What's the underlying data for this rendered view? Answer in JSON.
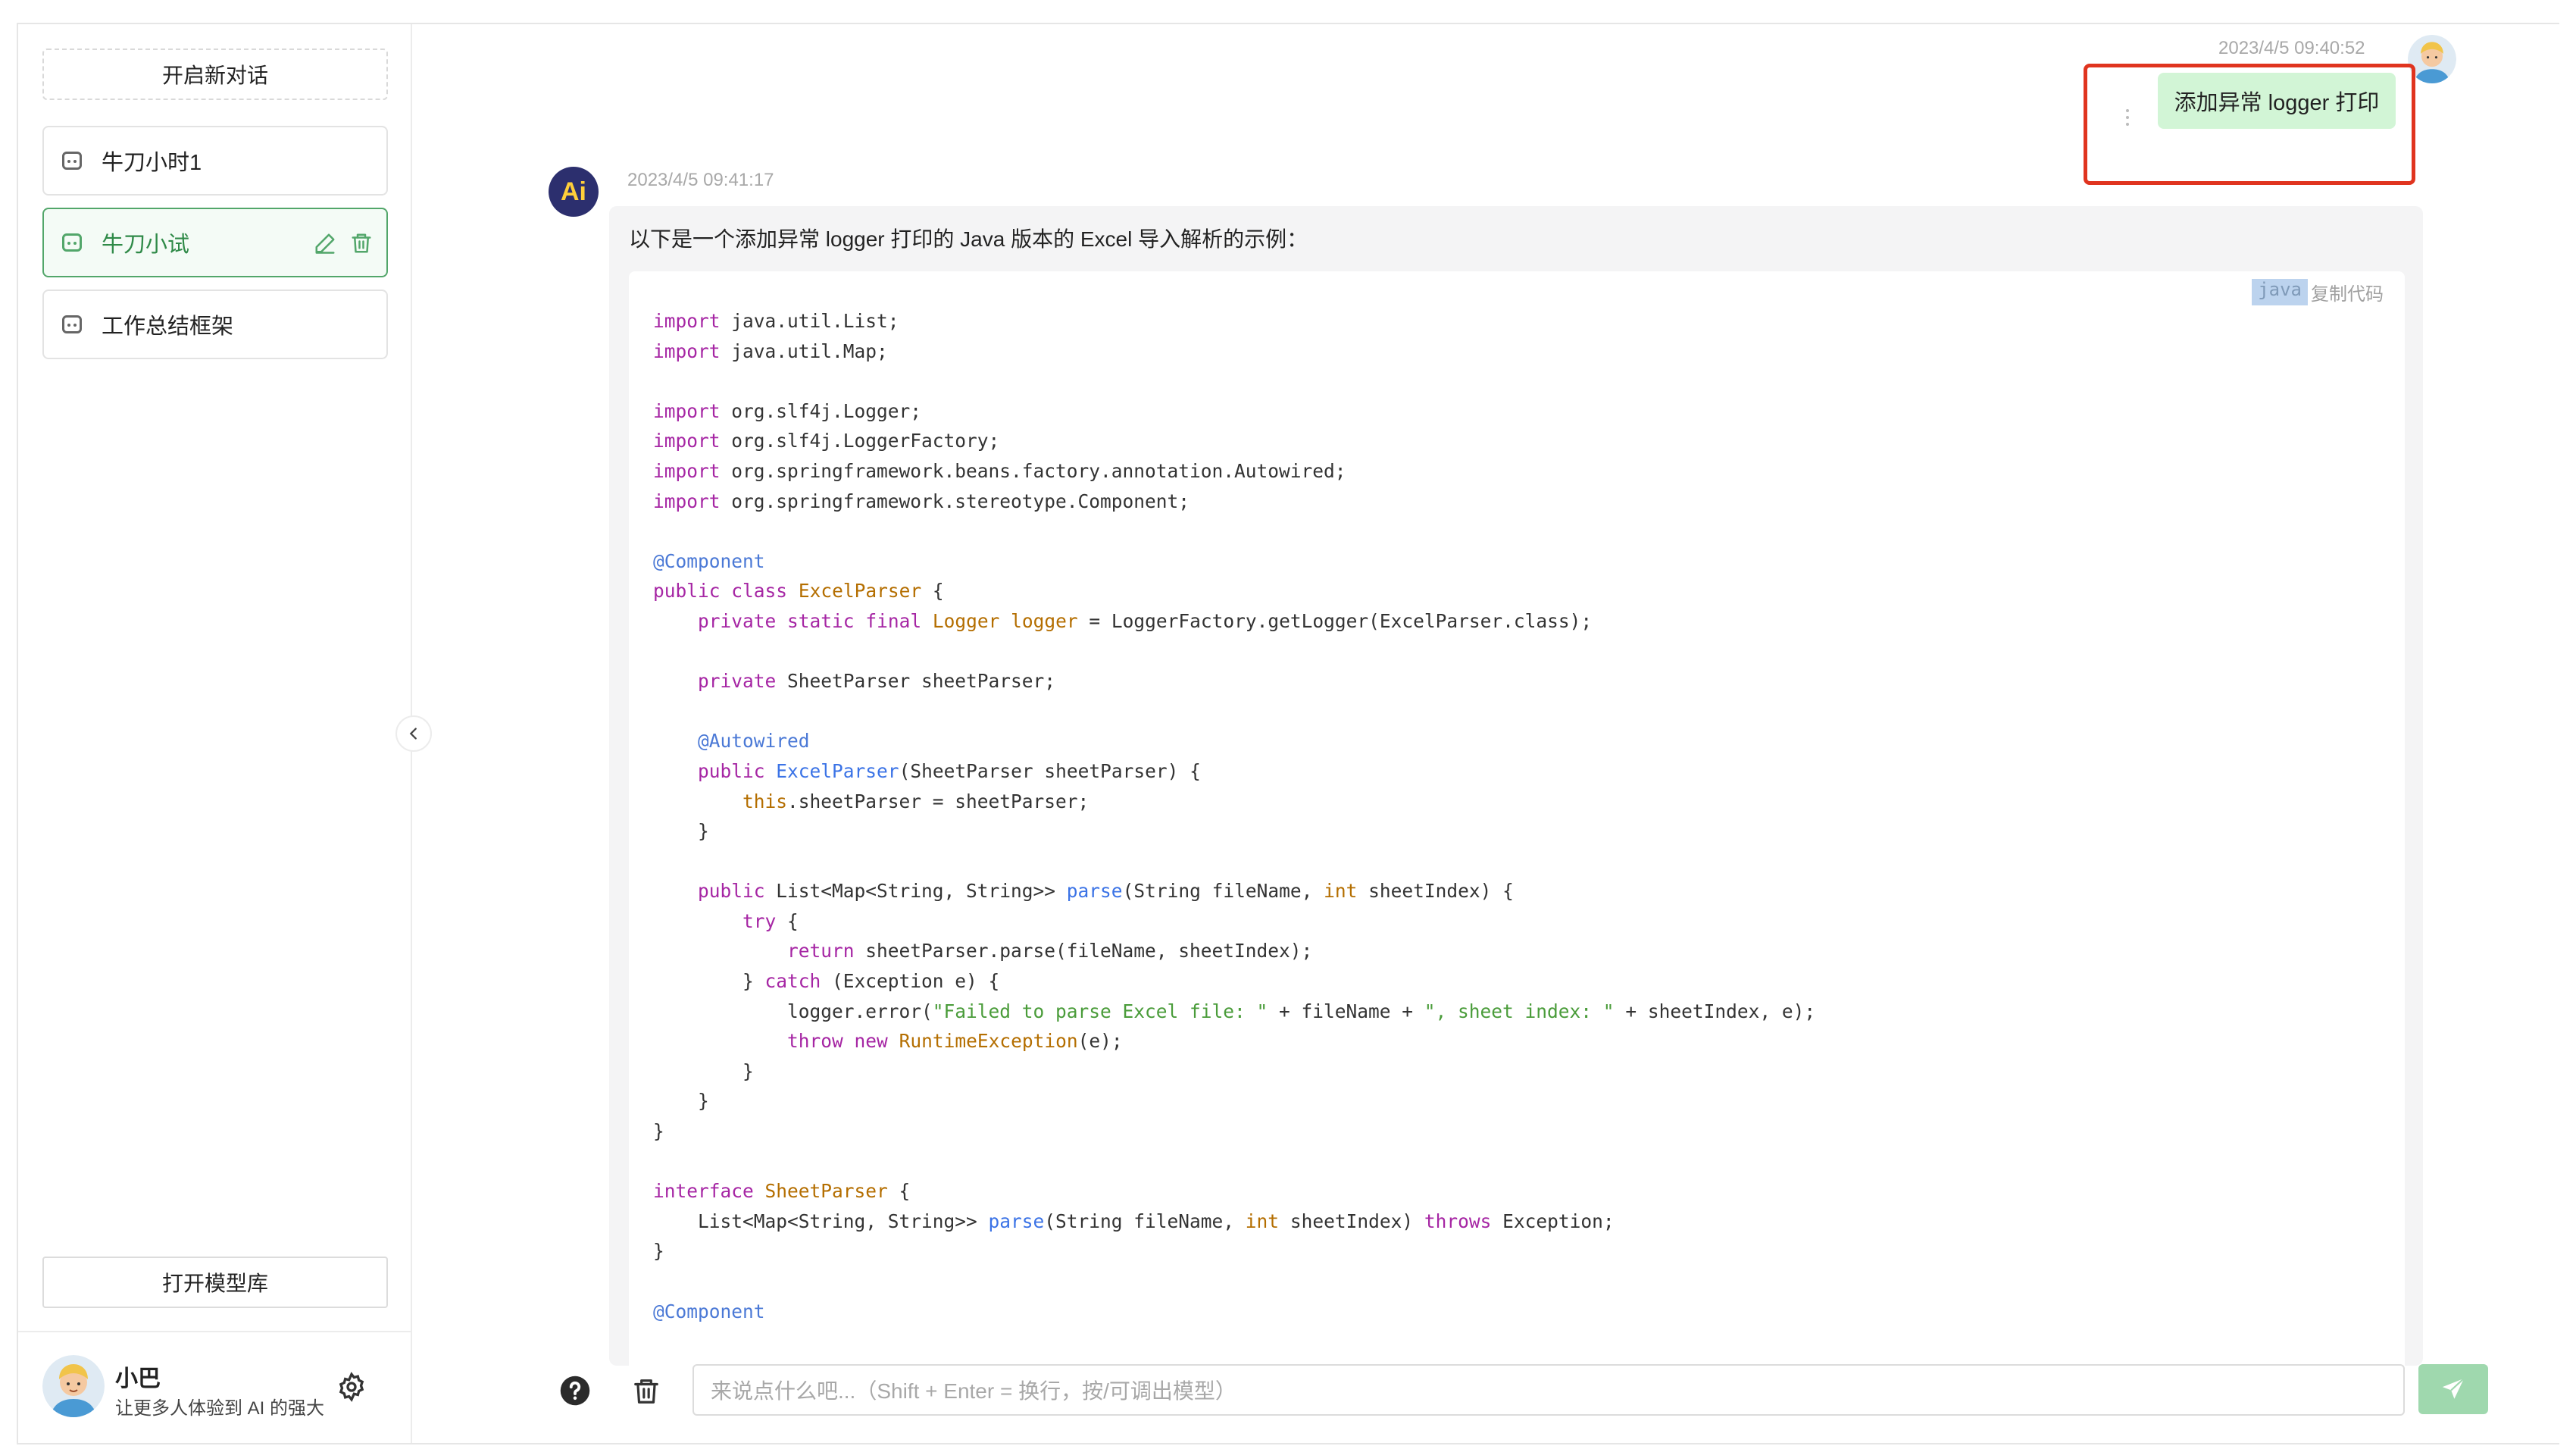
{
  "sidebar": {
    "new_chat": "开启新对话",
    "sessions": [
      {
        "title": "牛刀小时1"
      },
      {
        "title": "牛刀小试"
      },
      {
        "title": "工作总结框架"
      }
    ],
    "open_model_library": "打开模型库",
    "user": {
      "name": "小巴",
      "description": "让更多人体验到 AI 的强大"
    }
  },
  "chat": {
    "user_message": {
      "time": "2023/4/5 09:40:52",
      "text": "添加异常 logger 打印"
    },
    "ai_message": {
      "time": "2023/4/5 09:41:17",
      "avatar_text": "Ai",
      "intro": "以下是一个添加异常 logger 打印的 Java 版本的 Excel 导入解析的示例：",
      "code_language": "java",
      "copy_label": "复制代码"
    }
  },
  "composer": {
    "placeholder": "来说点什么吧...（Shift + Enter = 换行，按/可调出模型）"
  },
  "colors": {
    "accent": "#52a66a",
    "user_bubble": "#d2f5d6",
    "highlight": "#e0341f",
    "send_button": "#9fd8ae"
  }
}
